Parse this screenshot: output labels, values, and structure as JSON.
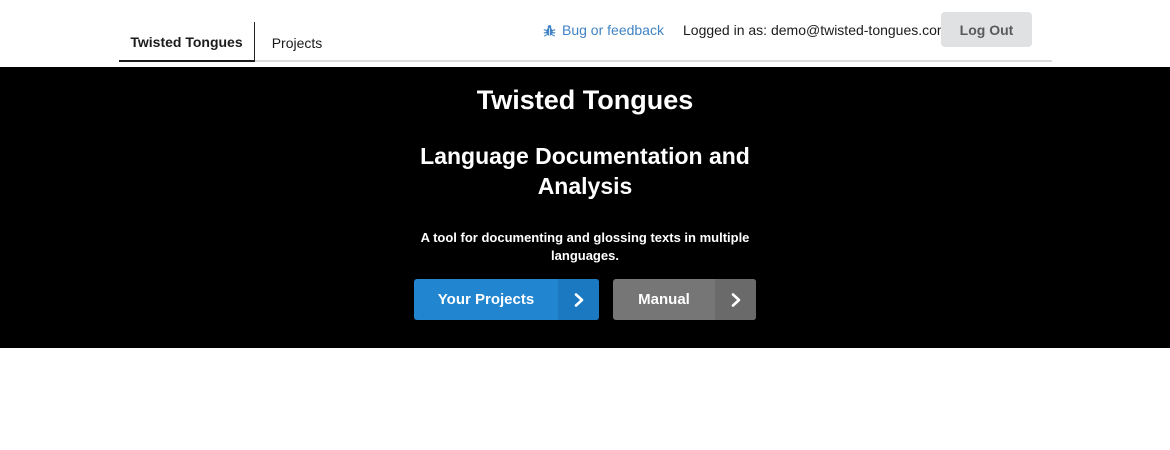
{
  "nav": {
    "tabs": [
      {
        "label": "Twisted Tongues",
        "active": true
      },
      {
        "label": "Projects",
        "active": false
      }
    ],
    "feedback": {
      "label": "Bug or feedback",
      "icon": "bug-icon"
    },
    "logged_in_text": "Logged in as: demo@twisted-tongues.com",
    "logout_label": "Log Out"
  },
  "hero": {
    "title": "Twisted Tongues",
    "subtitle": "Language Documentation and Analysis",
    "tagline": "A tool for documenting and glossing texts in multiple languages.",
    "primary_button": {
      "label": "Your Projects",
      "icon": "chevron-right-icon"
    },
    "secondary_button": {
      "label": "Manual",
      "icon": "chevron-right-icon"
    }
  },
  "colors": {
    "hero_background": "#000000",
    "primary_button": "#2185d0",
    "secondary_button": "#767676",
    "link": "#4183c4",
    "logout_button": "#e0e1e2"
  }
}
